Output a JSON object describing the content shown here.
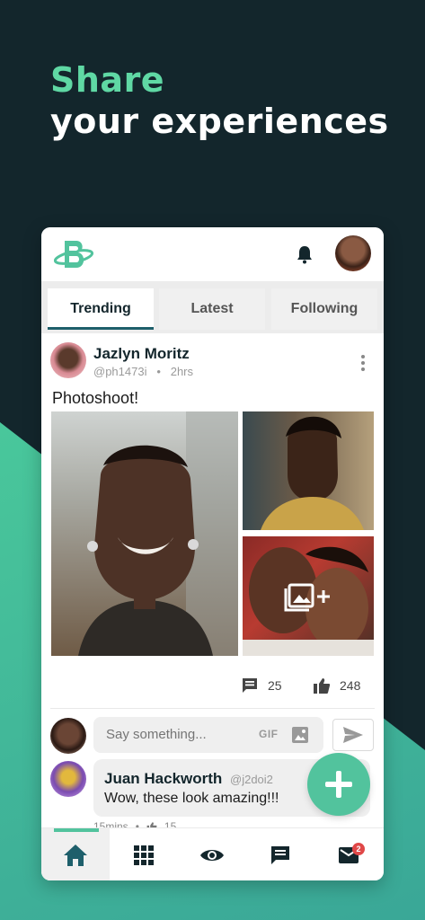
{
  "headline": {
    "line1": "Share",
    "line2": "your experiences"
  },
  "colors": {
    "brand_green": "#52c39d",
    "dark": "#13262c",
    "teal": "#1e5f6b"
  },
  "header": {
    "logo_icon": "brand-b-logo-icon",
    "bell_icon": "bell-icon"
  },
  "tabs": [
    {
      "label": "Trending",
      "active": true
    },
    {
      "label": "Latest",
      "active": false
    },
    {
      "label": "Following",
      "active": false
    }
  ],
  "post": {
    "author": "Jazlyn Moritz",
    "handle": "@ph1473i",
    "separator": "•",
    "time": "2hrs",
    "caption": "Photoshoot!",
    "comments_count": "25",
    "likes_count": "248"
  },
  "compose": {
    "placeholder": "Say something...",
    "gif_label": "GIF"
  },
  "comment": {
    "author": "Juan Hackworth",
    "handle": "@j2doi2",
    "text": "Wow, these look amazing!!!",
    "time": "15mins",
    "separator": "•",
    "likes": "15"
  },
  "bottom_nav": {
    "items": [
      "home-icon",
      "grid-icon",
      "eye-icon",
      "chat-icon",
      "mail-icon"
    ],
    "mail_badge": "2"
  }
}
